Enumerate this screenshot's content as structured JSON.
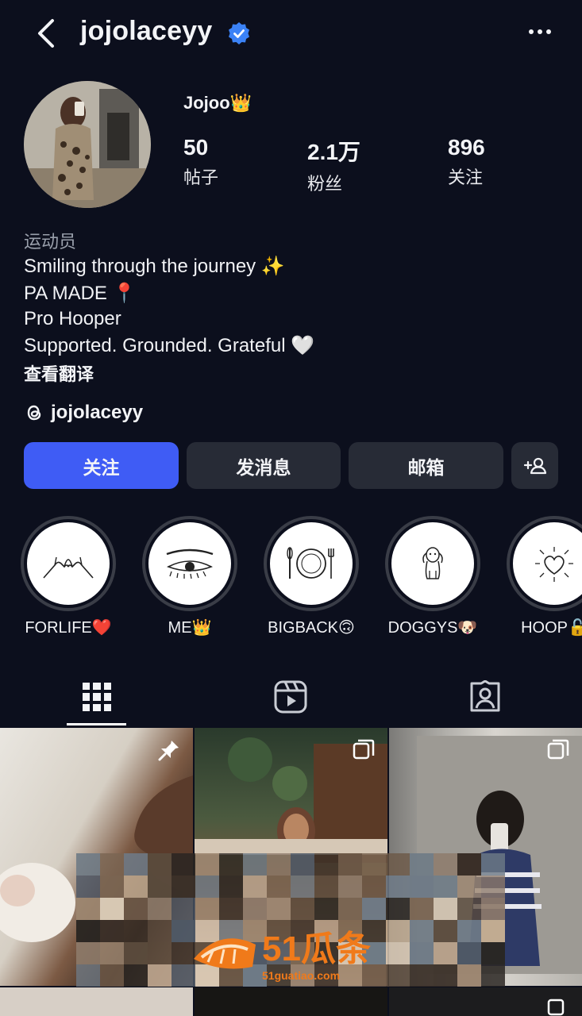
{
  "header": {
    "username": "jojolaceyy",
    "back_icon": "chevron-left-icon",
    "verified_icon": "verified-badge-icon",
    "more_icon": "more-horizontal-icon"
  },
  "profile": {
    "display_name": "Jojoo👑",
    "stats": [
      {
        "value": "50",
        "label": "帖子"
      },
      {
        "value": "2.1万",
        "label": "粉丝"
      },
      {
        "value": "896",
        "label": "关注"
      }
    ],
    "category": "运动员",
    "bio": [
      "Smiling through the journey ✨",
      "PA MADE 📍",
      "Pro Hooper",
      "Supported. Grounded. Grateful 🤍"
    ],
    "translate": "查看翻译",
    "threads_handle": "jojolaceyy"
  },
  "actions": {
    "follow": "关注",
    "message": "发消息",
    "email": "邮箱",
    "add_user_icon": "add-person-icon"
  },
  "highlights": [
    {
      "label": "FORLIFE❤️",
      "icon": "pinky-promise-icon"
    },
    {
      "label": "ME👑",
      "icon": "eye-lashes-icon"
    },
    {
      "label": "BIGBACK🙃",
      "icon": "plate-cutlery-icon"
    },
    {
      "label": "DOGGYS🐶",
      "icon": "dog-icon"
    },
    {
      "label": "HOOP🔓",
      "icon": "heart-burst-icon"
    }
  ],
  "tabs": [
    {
      "name": "grid",
      "icon": "grid-icon",
      "active": true
    },
    {
      "name": "reels",
      "icon": "reels-icon",
      "active": false
    },
    {
      "name": "tagged",
      "icon": "tagged-person-icon",
      "active": false
    }
  ],
  "watermark": {
    "brand": "51瓜条",
    "domain": "51guatiao.com"
  },
  "colors": {
    "background": "#0c0f1d",
    "primary_button": "#3f5cf5",
    "secondary_button": "#272b36",
    "verified": "#3b82f6"
  }
}
